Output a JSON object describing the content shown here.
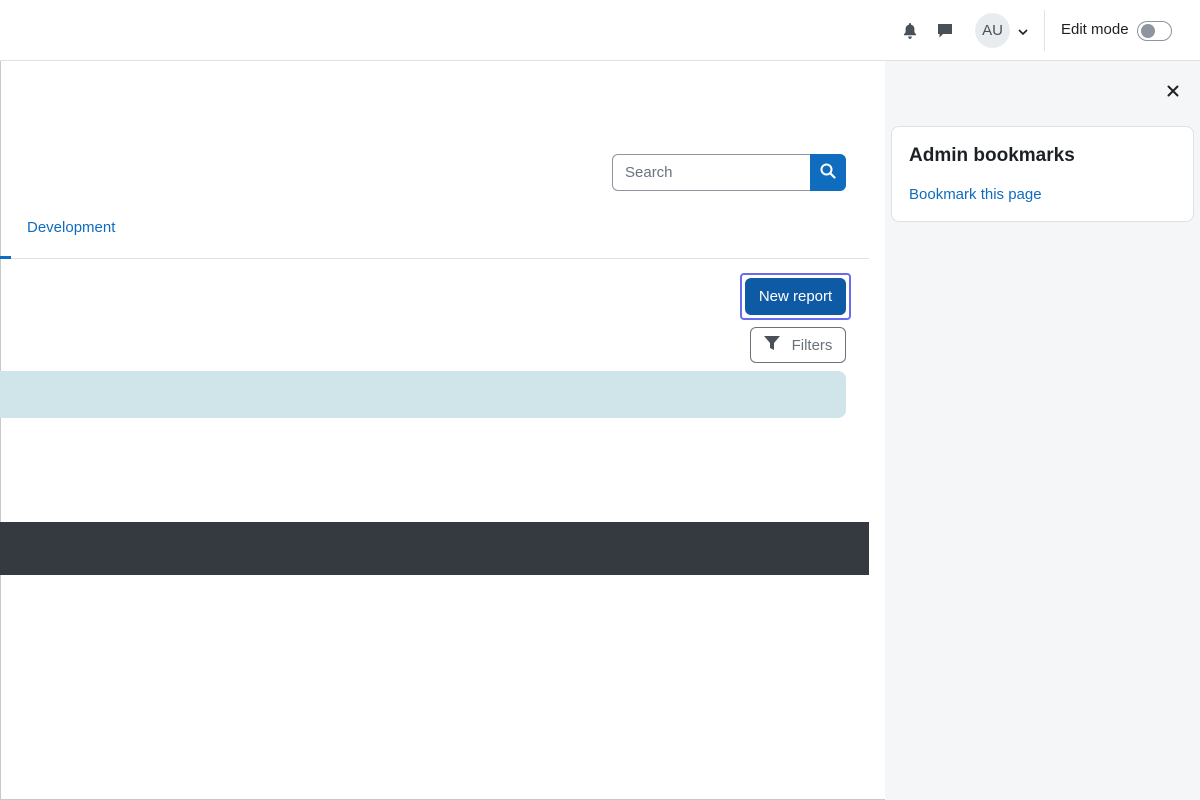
{
  "navbar": {
    "avatar_initials": "AU",
    "edit_mode_label": "Edit mode",
    "edit_mode_on": false
  },
  "main": {
    "search": {
      "placeholder": "Search"
    },
    "tabs": [
      {
        "label": "Development"
      }
    ],
    "new_report_label": "New report",
    "filters_label": "Filters"
  },
  "drawer": {
    "card_title": "Admin bookmarks",
    "card_link": "Bookmark this page"
  },
  "colors": {
    "primary": "#0f6cbf",
    "button_dark": "#0f5aa4",
    "info_bar": "#cfe5e9",
    "footer": "#343a40",
    "drawer_bg": "#f5f6f7"
  }
}
